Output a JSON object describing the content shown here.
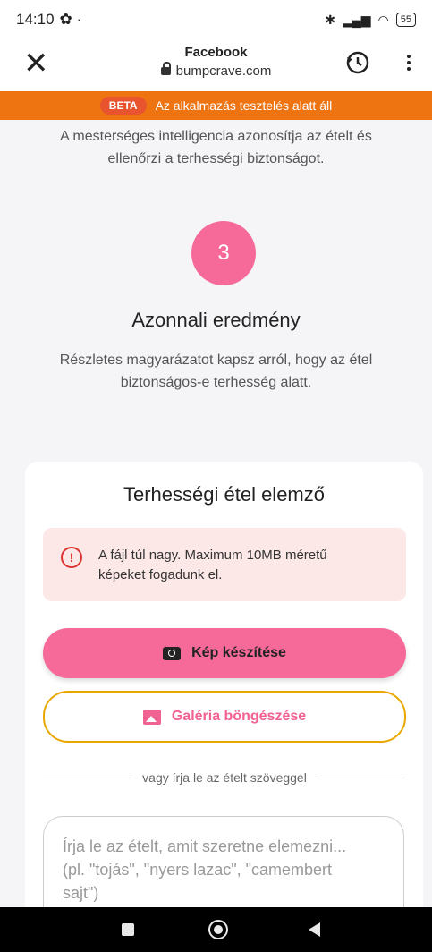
{
  "statusbar": {
    "time": "14:10",
    "extra": "✿ ·",
    "battery": "55"
  },
  "browser": {
    "title": "Facebook",
    "url": "bumpcrave.com"
  },
  "beta": {
    "badge": "BETA",
    "text": "Az alkalmazás tesztelés alatt áll"
  },
  "steps": {
    "step2_desc_line1": "A mesterséges intelligencia azonosítja az ételt és",
    "step2_desc_line2": "ellenőrzi a terhességi biztonságot.",
    "step3_number": "3",
    "step3_title": "Azonnali eredmény",
    "step3_desc_line1": "Részletes magyarázatot kapsz arról, hogy az étel",
    "step3_desc_line2": "biztonságos-e terhesség alatt."
  },
  "card": {
    "title": "Terhességi étel elemző",
    "error_line1": "A fájl túl nagy. Maximum 10MB méretű",
    "error_line2": "képeket fogadunk el.",
    "camera_button": "Kép készítése",
    "gallery_button": "Galéria böngészése",
    "divider_text": "vagy írja le az ételt szöveggel",
    "textarea_placeholder_line1": "Írja le az ételt, amit szeretne elemezni...",
    "textarea_placeholder_line2": "(pl. \"tojás\", \"nyers lazac\", \"camembert",
    "textarea_placeholder_line3": "sajt\")"
  },
  "colors": {
    "accent_pink": "#f56a99",
    "beta_orange": "#ee7412",
    "gallery_border": "#e8a800"
  },
  "icons": [
    "close-icon",
    "lock-icon",
    "history-icon",
    "more-icon",
    "error-icon",
    "camera-icon",
    "gallery-icon"
  ]
}
